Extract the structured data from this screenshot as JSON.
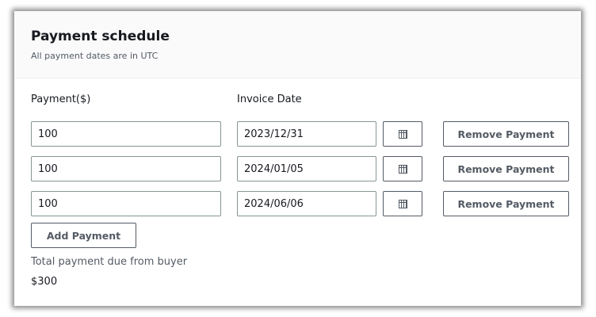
{
  "header": {
    "title": "Payment schedule",
    "subtitle": "All payment dates are in UTC"
  },
  "labels": {
    "payment": "Payment($)",
    "invoice_date": "Invoice Date"
  },
  "rows": [
    {
      "payment": "100",
      "date": "2023/12/31",
      "remove_label": "Remove Payment"
    },
    {
      "payment": "100",
      "date": "2024/01/05",
      "remove_label": "Remove Payment"
    },
    {
      "payment": "100",
      "date": "2024/06/06",
      "remove_label": "Remove Payment"
    }
  ],
  "add_label": "Add Payment",
  "total": {
    "label": "Total payment due from buyer",
    "value": "$300"
  },
  "icons": {
    "calendar": "calendar-icon"
  }
}
